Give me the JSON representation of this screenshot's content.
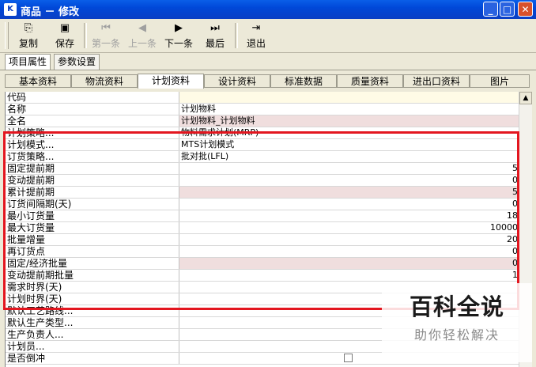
{
  "window": {
    "title": "商品 － 修改",
    "icon_text": "K"
  },
  "toolbar": [
    {
      "label": "复制",
      "icon": "copy-icon",
      "glyph": "⎘",
      "disabled": false
    },
    {
      "label": "保存",
      "icon": "save-icon",
      "glyph": "▣",
      "disabled": false
    },
    {
      "label": "第一条",
      "icon": "first-icon",
      "glyph": "⏮",
      "disabled": true
    },
    {
      "label": "上一条",
      "icon": "prev-icon",
      "glyph": "◀",
      "disabled": true
    },
    {
      "label": "下一条",
      "icon": "next-icon",
      "glyph": "▶",
      "disabled": false
    },
    {
      "label": "最后",
      "icon": "last-icon",
      "glyph": "⏭",
      "disabled": false
    },
    {
      "label": "退出",
      "icon": "exit-icon",
      "glyph": "⇥",
      "disabled": false
    }
  ],
  "tabs_top": [
    {
      "label": "项目属性",
      "active": true
    },
    {
      "label": "参数设置",
      "active": false
    }
  ],
  "tabs": [
    {
      "label": "基本资料",
      "active": false
    },
    {
      "label": "物流资料",
      "active": false
    },
    {
      "label": "计划资料",
      "active": true
    },
    {
      "label": "设计资料",
      "active": false
    },
    {
      "label": "标准数据",
      "active": false
    },
    {
      "label": "质量资料",
      "active": false
    },
    {
      "label": "进出口资料",
      "active": false
    },
    {
      "label": "图片",
      "active": false
    }
  ],
  "rows": [
    {
      "label": "代码",
      "value": "",
      "align": "left",
      "bg": "yellow"
    },
    {
      "label": "名称",
      "value": "计划物料",
      "align": "left",
      "bg": ""
    },
    {
      "label": "全名",
      "value": "计划物料_计划物料",
      "align": "left",
      "bg": "pink"
    },
    {
      "label": "计划策略...",
      "value": "物料需求计划(MRP)",
      "align": "left",
      "bg": ""
    },
    {
      "label": "计划模式...",
      "value": "MTS计划模式",
      "align": "left",
      "bg": ""
    },
    {
      "label": "订货策略...",
      "value": "批对批(LFL)",
      "align": "left",
      "bg": ""
    },
    {
      "label": "固定提前期",
      "value": "5",
      "align": "right",
      "bg": ""
    },
    {
      "label": "变动提前期",
      "value": "0",
      "align": "right",
      "bg": ""
    },
    {
      "label": "累计提前期",
      "value": "5",
      "align": "right",
      "bg": "pink"
    },
    {
      "label": "订货间隔期(天)",
      "value": "0",
      "align": "right",
      "bg": ""
    },
    {
      "label": "最小订货量",
      "value": "18",
      "align": "right",
      "bg": ""
    },
    {
      "label": "最大订货量",
      "value": "10000",
      "align": "right",
      "bg": ""
    },
    {
      "label": "批量增量",
      "value": "20",
      "align": "right",
      "bg": ""
    },
    {
      "label": "再订货点",
      "value": "0",
      "align": "right",
      "bg": ""
    },
    {
      "label": "固定/经济批量",
      "value": "0",
      "align": "right",
      "bg": "pink"
    },
    {
      "label": "变动提前期批量",
      "value": "1",
      "align": "right",
      "bg": ""
    },
    {
      "label": "需求时界(天)",
      "value": "",
      "align": "right",
      "bg": ""
    },
    {
      "label": "计划时界(天)",
      "value": "",
      "align": "right",
      "bg": ""
    },
    {
      "label": "默认工艺路线...",
      "value": "",
      "align": "left",
      "bg": ""
    },
    {
      "label": "默认生产类型...",
      "value": "",
      "align": "left",
      "bg": ""
    },
    {
      "label": "生产负责人...",
      "value": "",
      "align": "left",
      "bg": ""
    },
    {
      "label": "计划员...",
      "value": "",
      "align": "left",
      "bg": ""
    },
    {
      "label": "是否倒冲",
      "value": "",
      "align": "checkbox",
      "bg": ""
    }
  ],
  "watermark": {
    "main": "百科全说",
    "sub": "助你轻松解决"
  },
  "colors": {
    "highlight": "#e3161f",
    "pink_cell": "#f0dede",
    "titlebar": "#0048d8"
  }
}
